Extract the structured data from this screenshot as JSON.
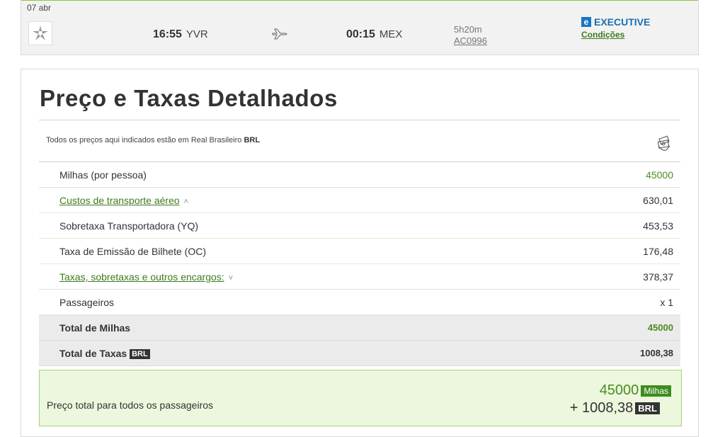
{
  "flight": {
    "date": "07 abr",
    "departure_time": "16:55",
    "departure_code": "YVR",
    "arrival_time": "00:15",
    "arrival_code": "MEX",
    "duration": "5h20m",
    "flight_number": "AC0996",
    "cabin_icon_letter": "e",
    "cabin": "EXECUTIVE",
    "conditions_link": "Condições",
    "icons": {
      "airline": "star-alliance-logo-icon",
      "plane": "plane-icon"
    }
  },
  "prices": {
    "title": "Preço e Taxas Detalhados",
    "note_prefix": "Todos os preços aqui indicados estão em Real Brasileiro ",
    "note_currency": "BRL",
    "icon": "money-icon",
    "rows": [
      {
        "label": "Milhas (por pessoa)",
        "value": "45000"
      },
      {
        "label": "Custos de transporte aéreo",
        "value": "630,01",
        "expanded": true
      },
      {
        "label": "Sobretaxa Transportadora (YQ)",
        "value": "453,53"
      },
      {
        "label": "Taxa de Emissão de Bilhete (OC)",
        "value": "176,48"
      },
      {
        "label": "Taxas, sobretaxas e outros encargos:",
        "value": "378,37",
        "expanded": false
      },
      {
        "label": "Passageiros",
        "value": "x 1"
      }
    ],
    "total_miles": {
      "label": "Total de Milhas",
      "value": "45000"
    },
    "total_taxes": {
      "label": "Total de Taxas",
      "tag": "BRL",
      "value": "1008,38"
    }
  },
  "summary": {
    "label": "Preço total para todos os passageiros",
    "miles_value": "45000",
    "miles_tag": "Milhas",
    "brl_value": "+ 1008,38",
    "brl_tag": "BRL"
  },
  "colors": {
    "accent_green": "#4c8c1f",
    "link_green": "#3d7a1e",
    "cabin_blue": "#1a6fb0",
    "summary_bg": "#ecf7dd"
  }
}
